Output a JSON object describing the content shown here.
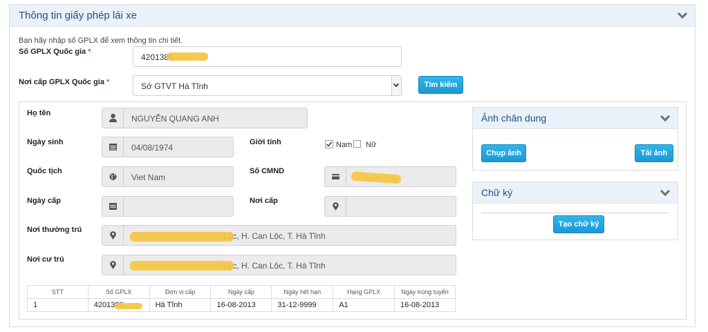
{
  "panel": {
    "title": "Thông tin giấy phép lái xe",
    "collapse_icon": "chevron-down-icon"
  },
  "search": {
    "hint": "Bạn hãy nhập số GPLX để xem thông tin chi tiết.",
    "license_label": "Số GPLX Quốc gia",
    "license_value": "4201380",
    "issuer_label": "Nơi cấp GPLX Quốc gia",
    "issuer_value": "Sở GTVT Hà Tĩnh",
    "required_mark": "*",
    "search_button": "Tìm kiếm"
  },
  "person": {
    "name_label": "Họ tên",
    "name_value": "NGUYỄN QUANG ANH",
    "dob_label": "Ngày sinh",
    "dob_value": "04/08/1974",
    "gender_label": "Giới tính",
    "gender_male": "Nam",
    "gender_female": "Nữ",
    "gender_selected": "Nam",
    "nationality_label": "Quốc tịch",
    "nationality_value": "Viet Nam",
    "id_label": "Số CMND",
    "id_value": "",
    "issue_date_label": "Ngày cấp",
    "issue_date_value": "",
    "issue_place_label": "Nơi cấp",
    "issue_place_value": "",
    "permanent_label": "Nơi thường trú",
    "permanent_value": "Lộc, H. Can Lộc, T. Hà Tĩnh",
    "current_label": "Nơi cư trú",
    "current_value": "Lộc, H. Can Lộc, T. Hà Tĩnh"
  },
  "table": {
    "headers": [
      "STT",
      "Số GPLX",
      "Đơn vị cấp",
      "Ngày cấp",
      "Ngày hết hạn",
      "Hạng GPLX",
      "Ngày trúng tuyển"
    ],
    "rows": [
      [
        "1",
        "4201380",
        "Hà Tĩnh",
        "16-08-2013",
        "31-12-9999",
        "A1",
        "16-08-2013"
      ]
    ]
  },
  "portrait": {
    "title": "Ảnh chân dung",
    "capture_button": "Chụp ảnh",
    "upload_button": "Tải ảnh"
  },
  "signature": {
    "title": "Chữ ký",
    "create_button": "Tạo chữ ký"
  },
  "colors": {
    "accent": "#1a98d4",
    "header_bg": "#eaf1f8",
    "title_blue": "#1e4f8f",
    "redaction": "#f5c542"
  }
}
